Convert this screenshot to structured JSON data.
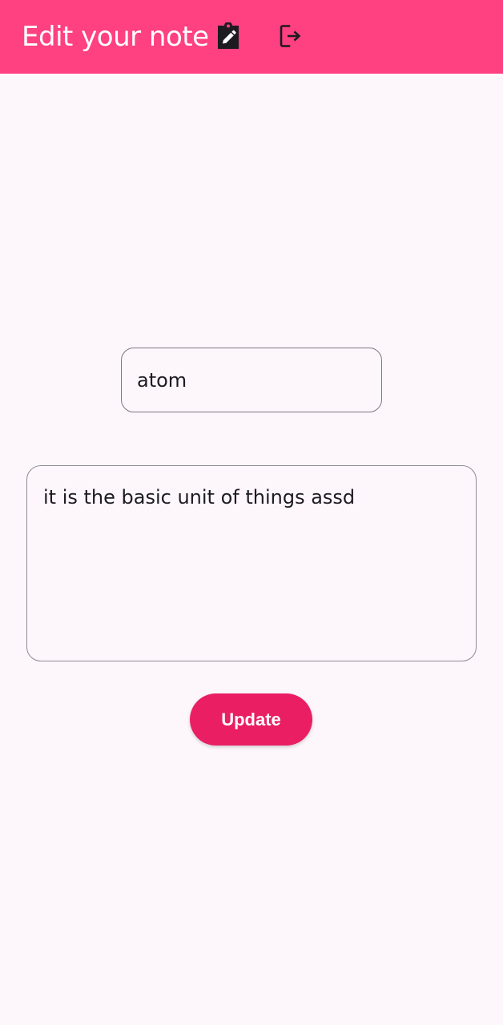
{
  "app_bar": {
    "title": "Edit your note",
    "background_color": "#ff4081",
    "actions": [
      {
        "icon": "edit-note-icon"
      },
      {
        "icon": "logout-icon"
      }
    ]
  },
  "form": {
    "title_field": {
      "value": "atom"
    },
    "content_field": {
      "value": "it is the basic unit of things assd"
    },
    "update_button": {
      "label": "Update",
      "color": "#e91e63"
    }
  },
  "background_color": "#fdf7fc"
}
